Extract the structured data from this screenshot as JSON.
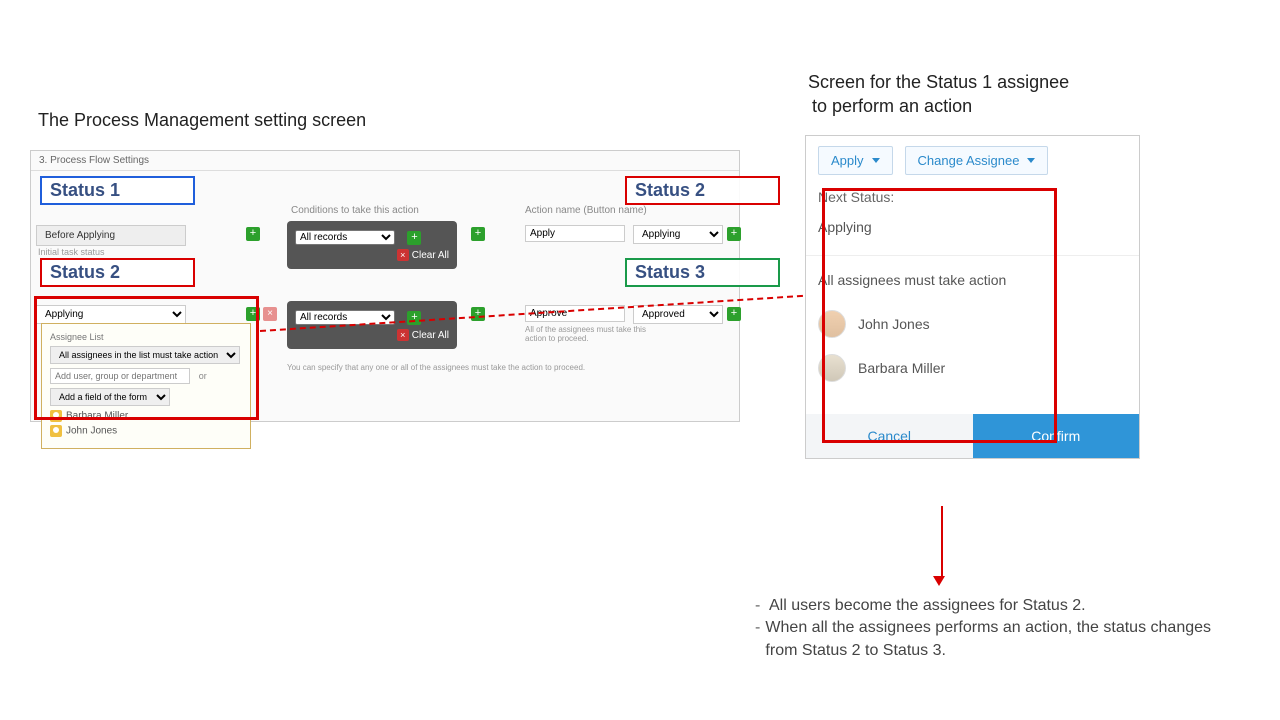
{
  "captions": {
    "left": "The Process Management setting screen",
    "right_line1": "Screen for the Status 1 assignee",
    "right_line2": "to perform an action"
  },
  "left_panel": {
    "title": "3. Process Flow Settings",
    "col_conditions": "Conditions to take this action",
    "col_action_name": "Action name (Button name)",
    "row1": {
      "status_name": "Before Applying",
      "status_sub": "Initial task status",
      "condition_option": "All records",
      "clear_all": "Clear All",
      "action_name": "Apply",
      "next_status": "Applying"
    },
    "row2": {
      "status_name": "Applying",
      "condition_option": "All records",
      "clear_all": "Clear All",
      "action_name": "Approve",
      "next_status": "Approved",
      "note": "All of the assignees must take this action to proceed.",
      "footer": "You can specify that any one or all of the assignees must take the action to proceed."
    },
    "assignee_box": {
      "title": "Assignee List",
      "mode": "All assignees in the list must take action",
      "add_user_placeholder": "Add user, group or department",
      "or": "or",
      "add_field": "Add a field of the form",
      "users": [
        "Barbara Miller",
        "John Jones"
      ]
    }
  },
  "highlights": {
    "s1": "Status 1",
    "s2": "Status 2",
    "s3": "Status 3"
  },
  "right_panel": {
    "apply_btn": "Apply",
    "change_assignee_btn": "Change Assignee",
    "next_status_label": "Next Status:",
    "next_status_value": "Applying",
    "assignee_note": "All assignees must take action",
    "persons": [
      "John Jones",
      "Barbara Miller"
    ],
    "cancel": "Cancel",
    "confirm": "Confirm"
  },
  "bullets": {
    "b1": "All users become the assignees for Status 2.",
    "b2": "When all the assignees performs an action, the status changes from Status 2 to Status 3."
  }
}
